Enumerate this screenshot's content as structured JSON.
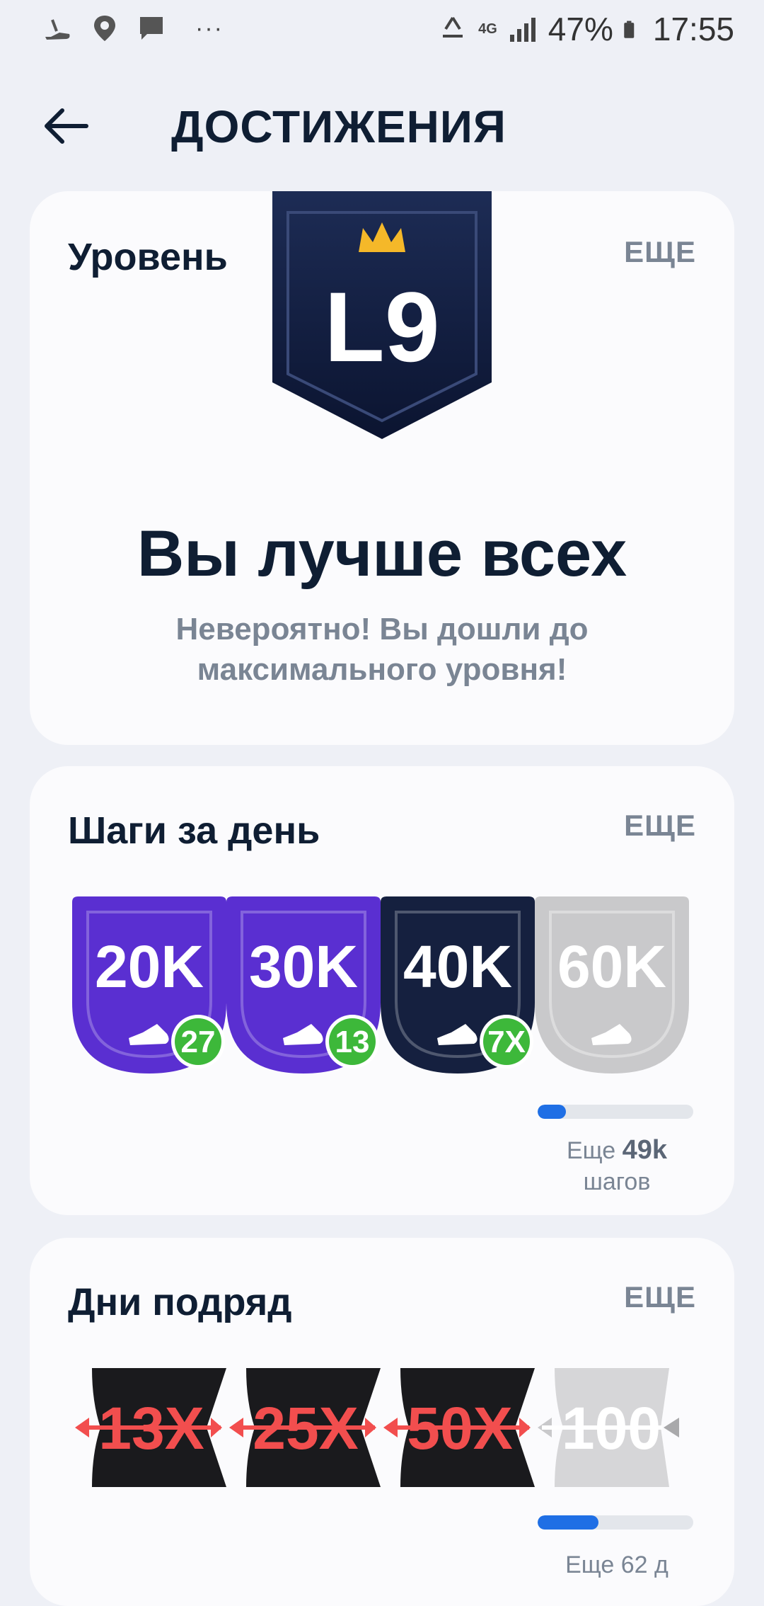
{
  "status_bar": {
    "battery": "47%",
    "time": "17:55",
    "network": "4G",
    "dots": "···"
  },
  "header": {
    "title": "ДОСТИЖЕНИЯ"
  },
  "level_card": {
    "title": "Уровень",
    "more": "ЕЩЕ",
    "badge_text": "L9",
    "headline": "Вы лучше всех",
    "subtitle_line1": "Невероятно! Вы дошли до",
    "subtitle_line2": "максимального уровня!"
  },
  "steps_card": {
    "title": "Шаги за день",
    "more": "ЕЩЕ",
    "badges": [
      {
        "label": "20K",
        "count": "27",
        "color": "#5a2fd1"
      },
      {
        "label": "30K",
        "count": "13",
        "color": "#5a2fd1"
      },
      {
        "label": "40K",
        "count": "7X",
        "color": "#15203f"
      },
      {
        "label": "60K",
        "count": "",
        "color": "#c9c9cb"
      }
    ],
    "progress_fraction": 0.18,
    "remaining_prefix": "Еще",
    "remaining_value": "49k",
    "remaining_unit": "шагов"
  },
  "streak_card": {
    "title": "Дни подряд",
    "more": "ЕЩЕ",
    "badges": [
      {
        "label": "13X",
        "achieved": true
      },
      {
        "label": "25X",
        "achieved": true
      },
      {
        "label": "50X",
        "achieved": true
      },
      {
        "label": "100",
        "achieved": false
      }
    ],
    "progress_fraction": 0.39,
    "remaining_text": "Еще 62 д"
  },
  "colors": {
    "accent_blue": "#1f6fe5",
    "count_green": "#3db83a",
    "streak_red": "#f24e4e"
  }
}
